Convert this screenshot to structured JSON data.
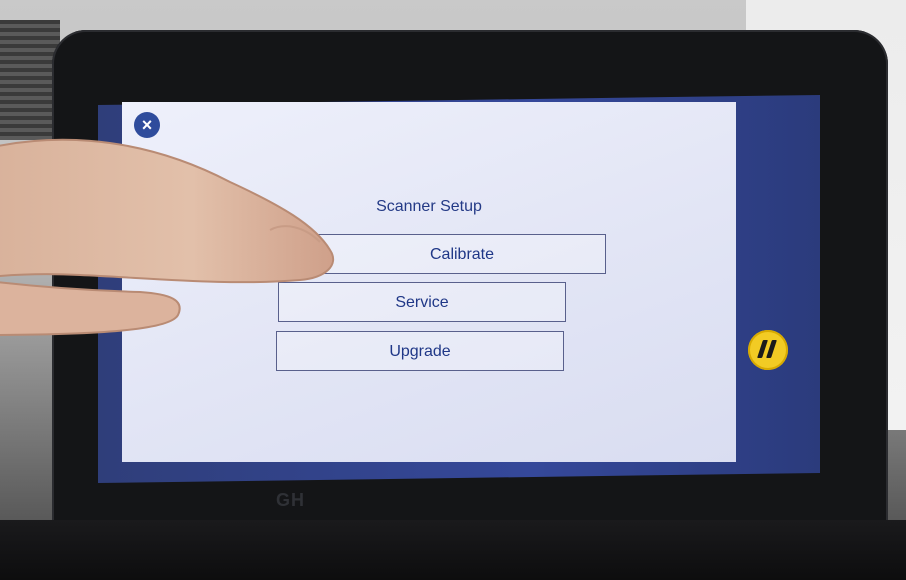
{
  "screen": {
    "title": "Scanner Setup",
    "buttons": {
      "calibrate": "Calibrate",
      "service": "Service",
      "upgrade": "Upgrade"
    },
    "close_icon": "close-icon"
  },
  "device": {
    "pause_icon": "pause-icon",
    "logo_text": "GH"
  },
  "colors": {
    "accent_blue": "#243a86",
    "pause_yellow": "#f2cb24",
    "screen_bg": "#e4e7f6",
    "bezel": "#141517"
  }
}
